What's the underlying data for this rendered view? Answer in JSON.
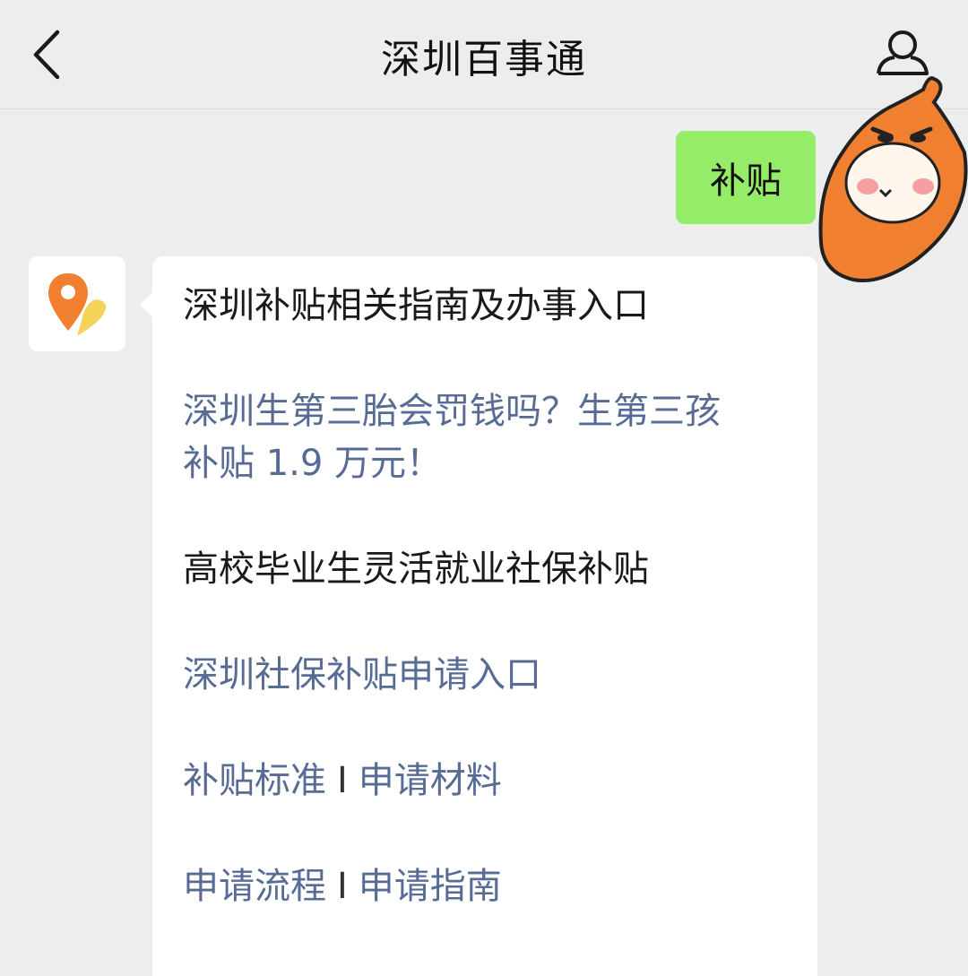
{
  "header": {
    "title": "深圳百事通",
    "back_icon": "chevron-left-icon",
    "profile_icon": "person-icon"
  },
  "messages": {
    "user_text": "补贴",
    "bot": {
      "heading": "深圳补贴相关指南及办事入口",
      "link1_line1": "深圳生第三胎会罚钱吗？生第三孩",
      "link1_line2": "补贴 1.9 万元！",
      "subheading": "高校毕业生灵活就业社保补贴",
      "link2": "深圳社保补贴申请入口",
      "row1": {
        "a": "补贴标准",
        "sep": "I",
        "b": "申请材料"
      },
      "row2": {
        "a": "申请流程",
        "sep": "I",
        "b": "申请指南"
      }
    }
  },
  "colors": {
    "background": "#ededed",
    "user_bubble": "#95ec69",
    "link": "#576b95",
    "avatar_orange": "#f08030"
  }
}
